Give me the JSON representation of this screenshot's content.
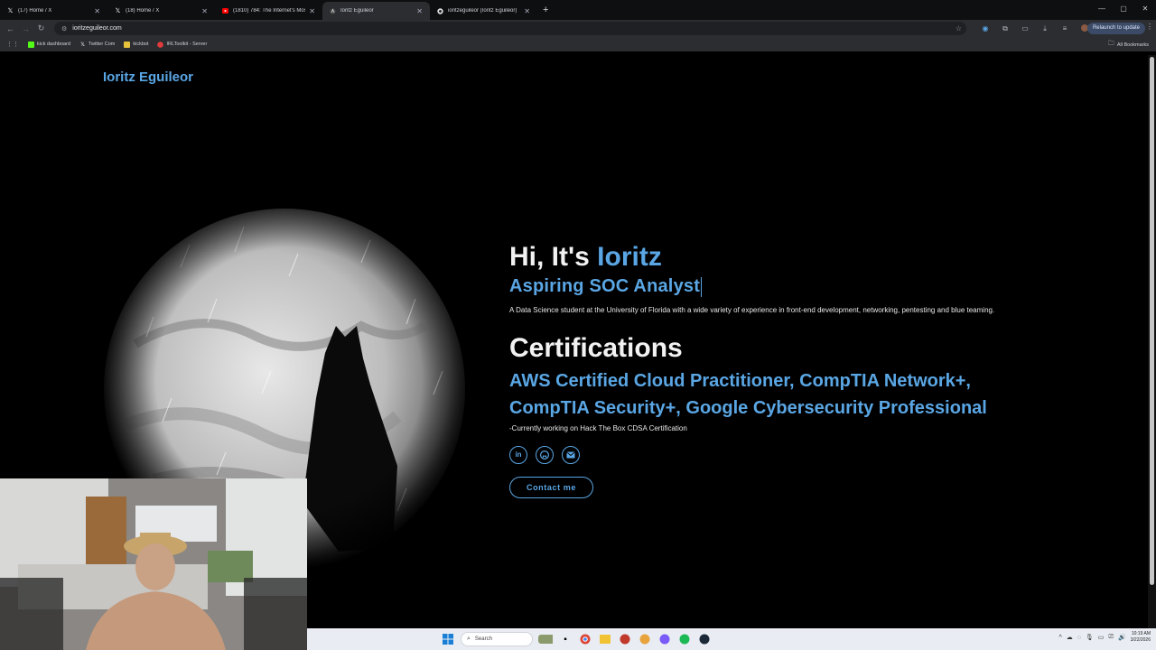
{
  "browser": {
    "tabs": [
      {
        "title": "(17) Home / X",
        "icon": "x-logo-icon"
      },
      {
        "title": "(18) Home / X",
        "icon": "x-logo-icon"
      },
      {
        "title": "(1810) 784: The Internet's Most",
        "icon": "youtube-icon"
      },
      {
        "title": "Ioritz Eguileor",
        "icon": "site-icon"
      },
      {
        "title": "ioritzeguileor (Ioritz Eguileor)",
        "icon": "github-icon"
      }
    ],
    "url": "ioritzeguileor.com",
    "relaunch_label": "Relaunch to update",
    "bookmarks": [
      {
        "label": "kick dashboard",
        "icon": "kick-icon"
      },
      {
        "label": "Twitter Com",
        "icon": "x-logo-icon"
      },
      {
        "label": "kickbot",
        "icon": "bot-icon"
      },
      {
        "label": "IRLToolkit - Server",
        "icon": "irl-icon"
      }
    ],
    "all_bookmarks_label": "All Bookmarks"
  },
  "site": {
    "brand": "Ioritz Eguileor",
    "greeting_prefix": "Hi, It's",
    "greeting_name": "Ioritz",
    "role": "Aspiring SOC Analyst",
    "description": "A Data Science student at the University of Florida with a wide variety of experience in front-end development, networking, pentesting and blue teaming.",
    "cert_heading": "Certifications",
    "certs_line1": "AWS Certified Cloud Practitioner, CompTIA Network+,",
    "certs_line2": "CompTIA Security+, Google Cybersecurity Professional",
    "note": "-Currently working on Hack The Box CDSA Certification",
    "social_icons": [
      "linkedin-icon",
      "github-icon",
      "email-icon"
    ],
    "contact_label": "Contact me",
    "accent": "#5aa6e4"
  },
  "taskbar": {
    "search_placeholder": "Search",
    "time": "10:19 AM",
    "date": "3/22/2026"
  }
}
